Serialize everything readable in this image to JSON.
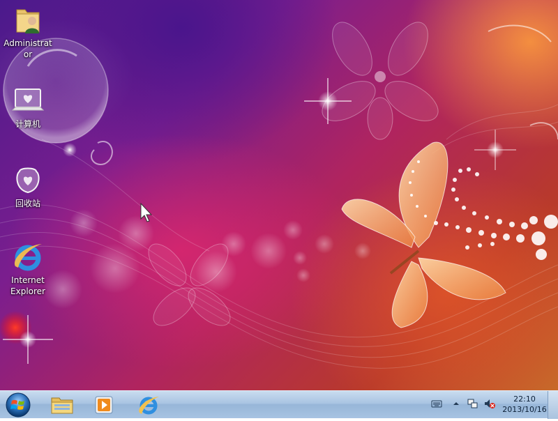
{
  "desktop": {
    "icons": [
      {
        "label": "Administrator",
        "icon": "user-folder-icon"
      },
      {
        "label": "计算机",
        "icon": "computer-icon"
      },
      {
        "label": "回收站",
        "icon": "recycle-bin-icon"
      },
      {
        "label": "Internet Explorer",
        "icon": "internet-explorer-icon"
      }
    ],
    "wallpaper": "butterfly-flower-wallpaper"
  },
  "taskbar": {
    "start_icon": "windows-start-icon",
    "pinned": [
      {
        "icon": "file-explorer-icon"
      },
      {
        "icon": "media-player-icon"
      },
      {
        "icon": "internet-explorer-icon"
      }
    ],
    "tray": {
      "icons": [
        "keyboard-icon",
        "show-hidden-icons-arrow",
        "network-icon",
        "volume-muted-icon"
      ]
    },
    "clock": {
      "time": "22:10",
      "date": "2013/10/16"
    }
  },
  "colors": {
    "taskbar_top": "#c9dcef",
    "taskbar_bottom": "#a7c3e2",
    "accent_blue": "#1f6fd0"
  }
}
